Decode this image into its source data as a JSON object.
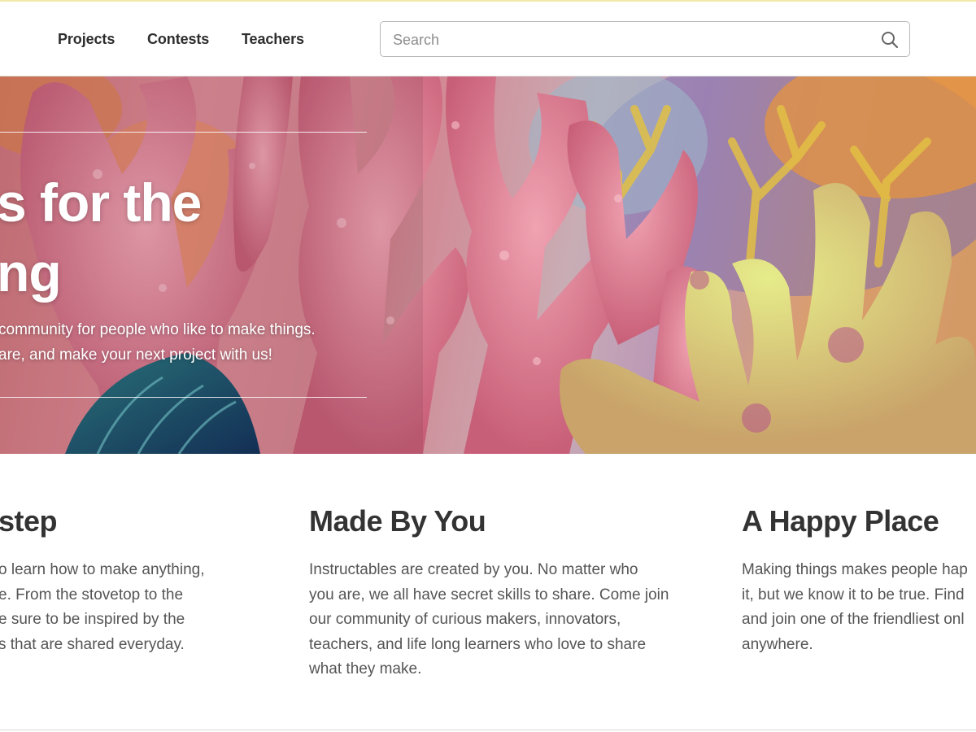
{
  "nav": {
    "links": [
      "Projects",
      "Contests",
      "Teachers"
    ],
    "search": {
      "placeholder": "Search",
      "value": ""
    }
  },
  "hero": {
    "title_line1": "s for the",
    "title_line2": "ng",
    "subtitle_line1": "community for people who like to make things.",
    "subtitle_line2": "are, and make your next project with us!"
  },
  "features": [
    {
      "title": "step",
      "text": "o learn how to make anything,\ne. From the stovetop to the\ne sure to be inspired by the\ns that are shared everyday."
    },
    {
      "title": "Made By You",
      "text": "Instructables are created by you. No matter who\nyou are, we all have secret skills to share. Come join\nour community of curious makers, innovators,\nteachers, and life long learners who love to share\nwhat they make."
    },
    {
      "title": "A Happy Place",
      "text": "Making things makes people hap\nit, but we know it to be true. Find\nand join one of the friendliest onl\nanywhere."
    }
  ],
  "colors": {
    "nav_text": "#2d2d2d",
    "heading": "#333333",
    "body_text": "#555555",
    "coral_pink": "#e27d93",
    "coral_yellow": "#d9dd7a"
  },
  "icons": {
    "search": "search-icon"
  }
}
